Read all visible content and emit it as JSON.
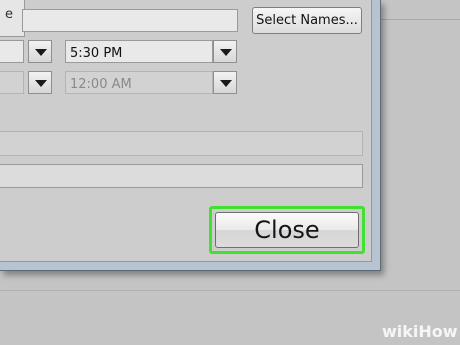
{
  "dialog": {
    "label_fragment": "e",
    "select_names_label": "Select Names...",
    "start_time": {
      "value": "5:30 PM"
    },
    "end_time": {
      "value": "12:00 AM",
      "disabled": true
    },
    "close_label": "Close"
  },
  "watermark": {
    "part1": "wiki",
    "part2": "How"
  },
  "colors": {
    "highlight": "#40e232"
  },
  "icons": [
    "dropdown-arrow-icon"
  ]
}
